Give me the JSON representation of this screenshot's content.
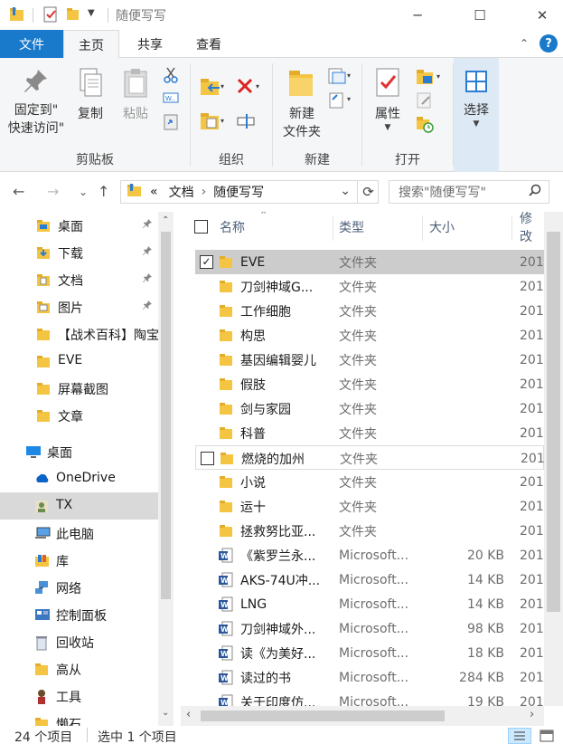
{
  "window": {
    "title": "随便写写",
    "controls": {
      "minimize": "─",
      "maximize": "☐",
      "close": "✕"
    }
  },
  "ribbon_tabs": {
    "file": "文件",
    "home": "主页",
    "share": "共享",
    "view": "查看"
  },
  "ribbon": {
    "clipboard": {
      "label": "剪贴板",
      "pin_line1": "固定到\"",
      "pin_line2": "快速访问\"",
      "copy": "复制",
      "paste": "粘贴"
    },
    "organize": {
      "label": "组织"
    },
    "new": {
      "label": "新建",
      "new_folder_line1": "新建",
      "new_folder_line2": "文件夹"
    },
    "open": {
      "label": "打开",
      "properties": "属性"
    },
    "select": {
      "label": "选择"
    }
  },
  "address": {
    "overflow": "«",
    "segments": [
      "文档",
      "随便写写"
    ],
    "search_placeholder": "搜索\"随便写写\""
  },
  "nav": {
    "items": [
      {
        "label": "桌面",
        "icon": "folder-blue-icon",
        "pinned": true
      },
      {
        "label": "下载",
        "icon": "download-folder-icon",
        "pinned": true
      },
      {
        "label": "文档",
        "icon": "documents-folder-icon",
        "pinned": true
      },
      {
        "label": "图片",
        "icon": "pictures-folder-icon",
        "pinned": true
      },
      {
        "label": "【战术百科】陶宝",
        "icon": "folder-icon",
        "pinned": false
      },
      {
        "label": "EVE",
        "icon": "folder-icon",
        "pinned": false
      },
      {
        "label": "屏幕截图",
        "icon": "folder-icon",
        "pinned": false
      },
      {
        "label": "文章",
        "icon": "folder-icon",
        "pinned": false
      },
      {
        "label": "桌面",
        "icon": "desktop-icon",
        "pinned": false
      },
      {
        "label": "OneDrive",
        "icon": "onedrive-icon",
        "pinned": false
      },
      {
        "label": "TX",
        "icon": "user-icon",
        "pinned": false
      },
      {
        "label": "此电脑",
        "icon": "computer-icon",
        "pinned": false
      },
      {
        "label": "库",
        "icon": "library-icon",
        "pinned": false
      },
      {
        "label": "网络",
        "icon": "network-icon",
        "pinned": false
      },
      {
        "label": "控制面板",
        "icon": "control-panel-icon",
        "pinned": false
      },
      {
        "label": "回收站",
        "icon": "recycle-bin-icon",
        "pinned": false
      },
      {
        "label": "高从",
        "icon": "folder-icon",
        "pinned": false
      },
      {
        "label": "工具",
        "icon": "tools-icon",
        "pinned": false
      },
      {
        "label": "懒石",
        "icon": "folder-icon",
        "pinned": false
      }
    ]
  },
  "columns": {
    "name": "名称",
    "type": "类型",
    "size": "大小",
    "modified": "修改"
  },
  "files": [
    {
      "name": "EVE",
      "type": "文件夹",
      "size": "",
      "date": "201",
      "kind": "folder",
      "checked": true
    },
    {
      "name": "刀剑神域G...",
      "type": "文件夹",
      "size": "",
      "date": "201",
      "kind": "folder"
    },
    {
      "name": "工作细胞",
      "type": "文件夹",
      "size": "",
      "date": "201",
      "kind": "folder"
    },
    {
      "name": "构思",
      "type": "文件夹",
      "size": "",
      "date": "201",
      "kind": "folder"
    },
    {
      "name": "基因编辑婴儿",
      "type": "文件夹",
      "size": "",
      "date": "201",
      "kind": "folder"
    },
    {
      "name": "假肢",
      "type": "文件夹",
      "size": "",
      "date": "201",
      "kind": "folder"
    },
    {
      "name": "剑与家园",
      "type": "文件夹",
      "size": "",
      "date": "201",
      "kind": "folder"
    },
    {
      "name": "科普",
      "type": "文件夹",
      "size": "",
      "date": "201",
      "kind": "folder"
    },
    {
      "name": "燃烧的加州",
      "type": "文件夹",
      "size": "",
      "date": "201",
      "kind": "folder",
      "checkbox": true
    },
    {
      "name": "小说",
      "type": "文件夹",
      "size": "",
      "date": "201",
      "kind": "folder"
    },
    {
      "name": "运十",
      "type": "文件夹",
      "size": "",
      "date": "201",
      "kind": "folder"
    },
    {
      "name": "拯救努比亚...",
      "type": "文件夹",
      "size": "",
      "date": "201",
      "kind": "folder"
    },
    {
      "name": "《紫罗兰永...",
      "type": "Microsoft...",
      "size": "20 KB",
      "date": "201",
      "kind": "word"
    },
    {
      "name": "AKS-74U冲...",
      "type": "Microsoft...",
      "size": "14 KB",
      "date": "201",
      "kind": "word"
    },
    {
      "name": "LNG",
      "type": "Microsoft...",
      "size": "14 KB",
      "date": "201",
      "kind": "word"
    },
    {
      "name": "刀剑神域外...",
      "type": "Microsoft...",
      "size": "98 KB",
      "date": "201",
      "kind": "word"
    },
    {
      "name": "读《为美好...",
      "type": "Microsoft...",
      "size": "18 KB",
      "date": "201",
      "kind": "word"
    },
    {
      "name": "读过的书",
      "type": "Microsoft...",
      "size": "284 KB",
      "date": "201",
      "kind": "word"
    },
    {
      "name": "关于印度仿...",
      "type": "Microsoft...",
      "size": "19 KB",
      "date": "201",
      "kind": "word"
    }
  ],
  "status": {
    "count": "24 个项目",
    "selected": "选中 1 个项目"
  },
  "colors": {
    "accent": "#1979ca",
    "selection": "#cccccc",
    "folder": "#f4c542",
    "word": "#2b579a"
  }
}
